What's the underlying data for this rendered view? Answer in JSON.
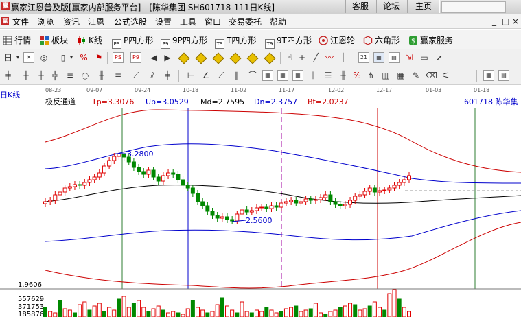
{
  "window": {
    "app_icon": "赢",
    "title": "赢家江恩普及版[赢家内部服务平台] - [陈华集团  SH601718-111日K线]",
    "buttons": [
      "客服",
      "论坛",
      "主页"
    ]
  },
  "menu": {
    "app_icon": "赢",
    "items": [
      "文件",
      "浏览",
      "资讯",
      "江恩",
      "公式选股",
      "设置",
      "工具",
      "窗口",
      "交易委托",
      "帮助"
    ],
    "window_controls": [
      "_",
      "□",
      "×"
    ]
  },
  "quickbar": {
    "items": [
      {
        "label": "行情",
        "icon": "grid-icon"
      },
      {
        "label": "板块",
        "icon": "blocks-icon"
      },
      {
        "label": "K线",
        "icon": "candle-icon"
      },
      {
        "label": "P四方形",
        "icon": "p-square-icon",
        "badge": "PS"
      },
      {
        "label": "9P四方形",
        "icon": "9p-square-icon",
        "badge": "P9"
      },
      {
        "label": "T四方形",
        "icon": "t-square-icon",
        "badge": "TS"
      },
      {
        "label": "9T四方形",
        "icon": "9t-square-icon",
        "badge": "T9"
      },
      {
        "label": "江恩轮",
        "icon": "wheel-icon"
      },
      {
        "label": "六角形",
        "icon": "hexagon-icon"
      },
      {
        "label": "赢家服务",
        "icon": "dollar-icon"
      }
    ]
  },
  "chart_data": {
    "type": "line",
    "panel_label": "日K线",
    "indicator_name": "极反通道",
    "stats": [
      {
        "key": "Tp",
        "label": "Tp=3.3076",
        "color": "#cc0000"
      },
      {
        "key": "Up",
        "label": "Up=3.0529",
        "color": "#0000cc"
      },
      {
        "key": "Md",
        "label": "Md=2.7595",
        "color": "#000000"
      },
      {
        "key": "Dn",
        "label": "Dn=2.3757",
        "color": "#0000cc"
      },
      {
        "key": "Bt",
        "label": "Bt=2.0237",
        "color": "#cc0000"
      }
    ],
    "stock_label": "601718  陈华集",
    "dates": [
      "08-23",
      "09-07",
      "09-24",
      "10-18",
      "11-02",
      "11-17",
      "12-02",
      "12-17",
      "01-03",
      "01-18"
    ],
    "high_annotation": "3.2800",
    "low_annotation": "2.5600",
    "ylim": [
      1.9606,
      3.55
    ],
    "y_bottom_label": "1.9606",
    "volume_labels": [
      "557629",
      "371753",
      "185876"
    ],
    "colors": {
      "up": "#e00000",
      "down": "#008800",
      "tp": "#cc0000",
      "up_band": "#0000cc",
      "mid": "#000000",
      "dn_band": "#0000cc",
      "bt": "#cc0000"
    }
  }
}
